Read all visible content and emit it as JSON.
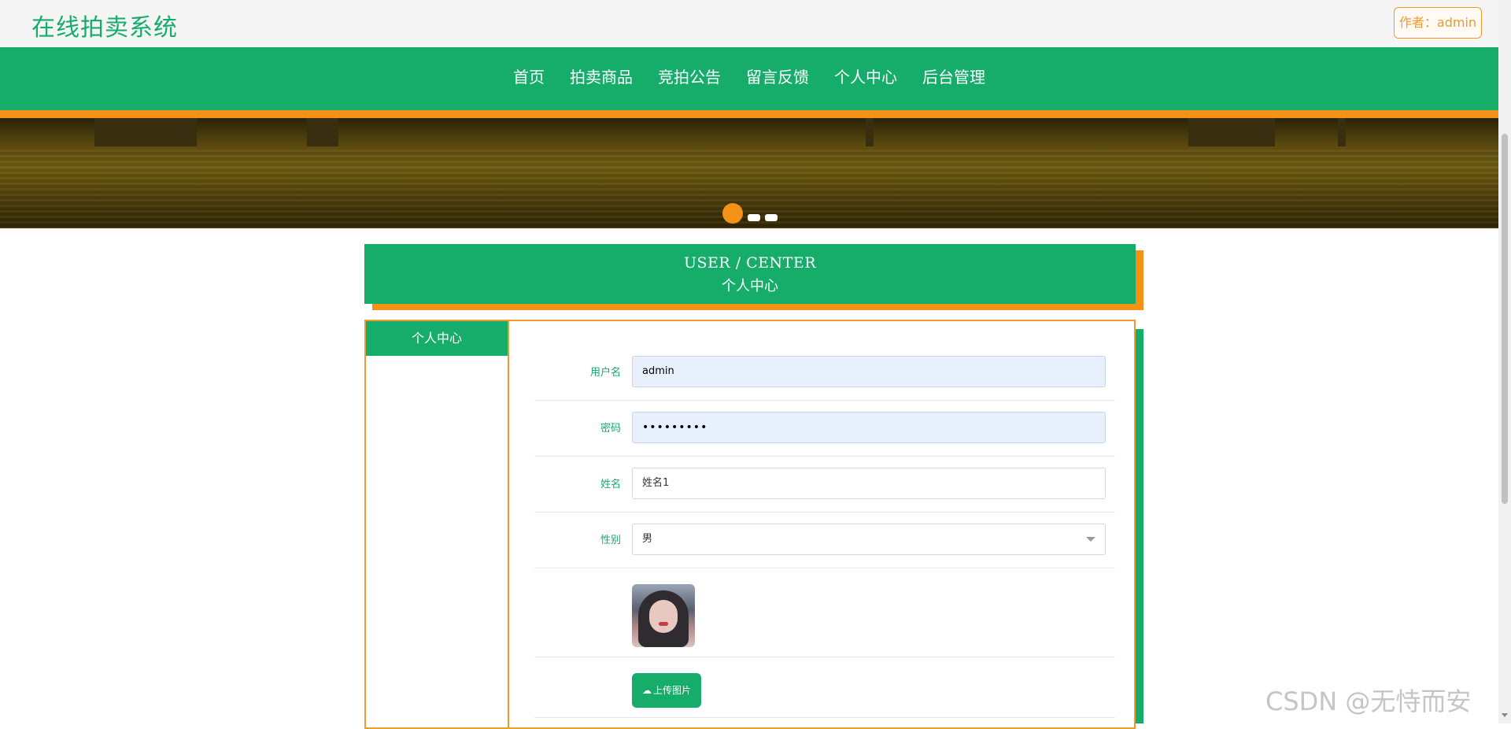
{
  "header": {
    "site_title": "在线拍卖系统",
    "author_label": "作者：admin"
  },
  "nav": {
    "items": [
      "首页",
      "拍卖商品",
      "竞拍公告",
      "留言反馈",
      "个人中心",
      "后台管理"
    ]
  },
  "carousel": {
    "active_index": 0,
    "dot_count": 3
  },
  "section": {
    "title_en": "USER / CENTER",
    "title_cn": "个人中心"
  },
  "sidebar": {
    "items": [
      "个人中心"
    ]
  },
  "form": {
    "username": {
      "label": "用户名",
      "value": "admin"
    },
    "password": {
      "label": "密码",
      "value": "•••••••••"
    },
    "name": {
      "label": "姓名",
      "value": "姓名1"
    },
    "gender": {
      "label": "性别",
      "value": "男"
    },
    "upload_label": "上传图片"
  },
  "watermark": "CSDN @无恃而安",
  "colors": {
    "primary": "#16ac6a",
    "accent": "#f39217"
  }
}
